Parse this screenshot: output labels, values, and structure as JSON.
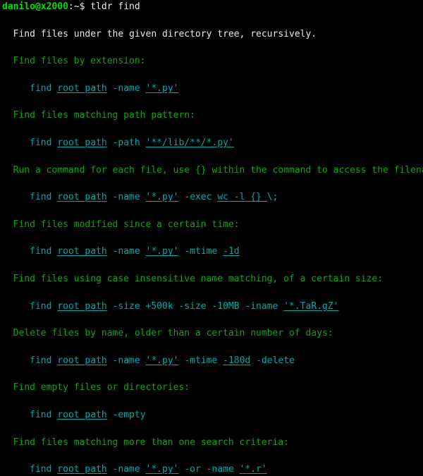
{
  "terminal": {
    "background_color": "#000000",
    "prompt": {
      "user_host": "danilo@x2000",
      "separator": ":~$",
      "typed_command": " tldr find",
      "user_host_color": "#00e000",
      "separator_color": "#e8e8e8",
      "typed_command_color": "#e8e8e8"
    },
    "page": {
      "description": "Find files under the given directory tree, recursively.",
      "description_color": "#e8e8e8",
      "heading_color": "#12a312",
      "command_color": "#00a8a8",
      "entries": [
        {
          "heading": "Find files by extension:",
          "command_parts": [
            {
              "text": "find ",
              "underline": false
            },
            {
              "text": "root_path",
              "underline": true
            },
            {
              "text": " -name ",
              "underline": false
            },
            {
              "text": "'*.py'",
              "underline": true
            }
          ]
        },
        {
          "heading": "Find files matching path pattern:",
          "command_parts": [
            {
              "text": "find ",
              "underline": false
            },
            {
              "text": "root_path",
              "underline": true
            },
            {
              "text": " -path ",
              "underline": false
            },
            {
              "text": "'**/lib/**/*.py'",
              "underline": true
            }
          ]
        },
        {
          "heading": "Run a command for each file, use {} within the command to access the filename:",
          "command_parts": [
            {
              "text": "find ",
              "underline": false
            },
            {
              "text": "root_path",
              "underline": true
            },
            {
              "text": " -name ",
              "underline": false
            },
            {
              "text": "'*.py'",
              "underline": true
            },
            {
              "text": " -exec ",
              "underline": false
            },
            {
              "text": "wc -l {} ",
              "underline": true
            },
            {
              "text": "\\;",
              "underline": false
            }
          ]
        },
        {
          "heading": "Find files modified since a certain time:",
          "command_parts": [
            {
              "text": "find ",
              "underline": false
            },
            {
              "text": "root_path",
              "underline": true
            },
            {
              "text": " -name ",
              "underline": false
            },
            {
              "text": "'*.py'",
              "underline": true
            },
            {
              "text": " -mtime ",
              "underline": false
            },
            {
              "text": "-1d",
              "underline": true
            }
          ]
        },
        {
          "heading": "Find files using case insensitive name matching, of a certain size:",
          "command_parts": [
            {
              "text": "find ",
              "underline": false
            },
            {
              "text": "root_path",
              "underline": true
            },
            {
              "text": " -size +500k -size -10MB -iname ",
              "underline": false
            },
            {
              "text": "'*.TaR.gZ'",
              "underline": true
            }
          ]
        },
        {
          "heading": "Delete files by name, older than a certain number of days:",
          "command_parts": [
            {
              "text": "find ",
              "underline": false
            },
            {
              "text": "root_path",
              "underline": true
            },
            {
              "text": " -name ",
              "underline": false
            },
            {
              "text": "'*.py'",
              "underline": true
            },
            {
              "text": " -mtime ",
              "underline": false
            },
            {
              "text": "-180d",
              "underline": true
            },
            {
              "text": " -delete",
              "underline": false
            }
          ]
        },
        {
          "heading": "Find empty files or directories:",
          "command_parts": [
            {
              "text": "find ",
              "underline": false
            },
            {
              "text": "root_path",
              "underline": true
            },
            {
              "text": " -empty",
              "underline": false
            }
          ]
        },
        {
          "heading": "Find files matching more than one search criteria:",
          "command_parts": [
            {
              "text": "find ",
              "underline": false
            },
            {
              "text": "root_path",
              "underline": true
            },
            {
              "text": " -name ",
              "underline": false
            },
            {
              "text": "'*.py'",
              "underline": true
            },
            {
              "text": " -or -name ",
              "underline": false
            },
            {
              "text": "'*.r'",
              "underline": true
            }
          ]
        }
      ],
      "heading_indent": "  ",
      "command_indent": "     "
    }
  }
}
